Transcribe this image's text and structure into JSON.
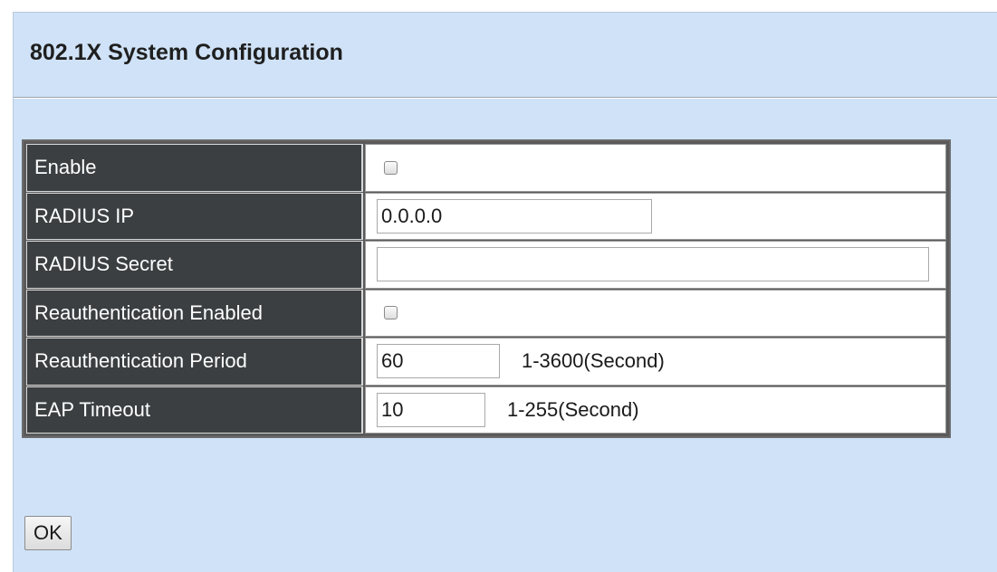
{
  "page": {
    "title": "802.1X System Configuration"
  },
  "form": {
    "enable": {
      "label": "Enable",
      "checked": false
    },
    "radius_ip": {
      "label": "RADIUS IP",
      "value": "0.0.0.0"
    },
    "radius_secret": {
      "label": "RADIUS Secret",
      "value": ""
    },
    "reauth_enabled": {
      "label": "Reauthentication Enabled",
      "checked": false
    },
    "reauth_period": {
      "label": "Reauthentication Period",
      "value": "60",
      "range": "1-3600(Second)"
    },
    "eap_timeout": {
      "label": "EAP Timeout",
      "value": "10",
      "range": "1-255(Second)"
    }
  },
  "actions": {
    "ok_label": "OK"
  },
  "colors": {
    "panel_background": "#cfe2f7",
    "label_cell_background": "#3b3f42",
    "label_text": "#ffffff"
  }
}
